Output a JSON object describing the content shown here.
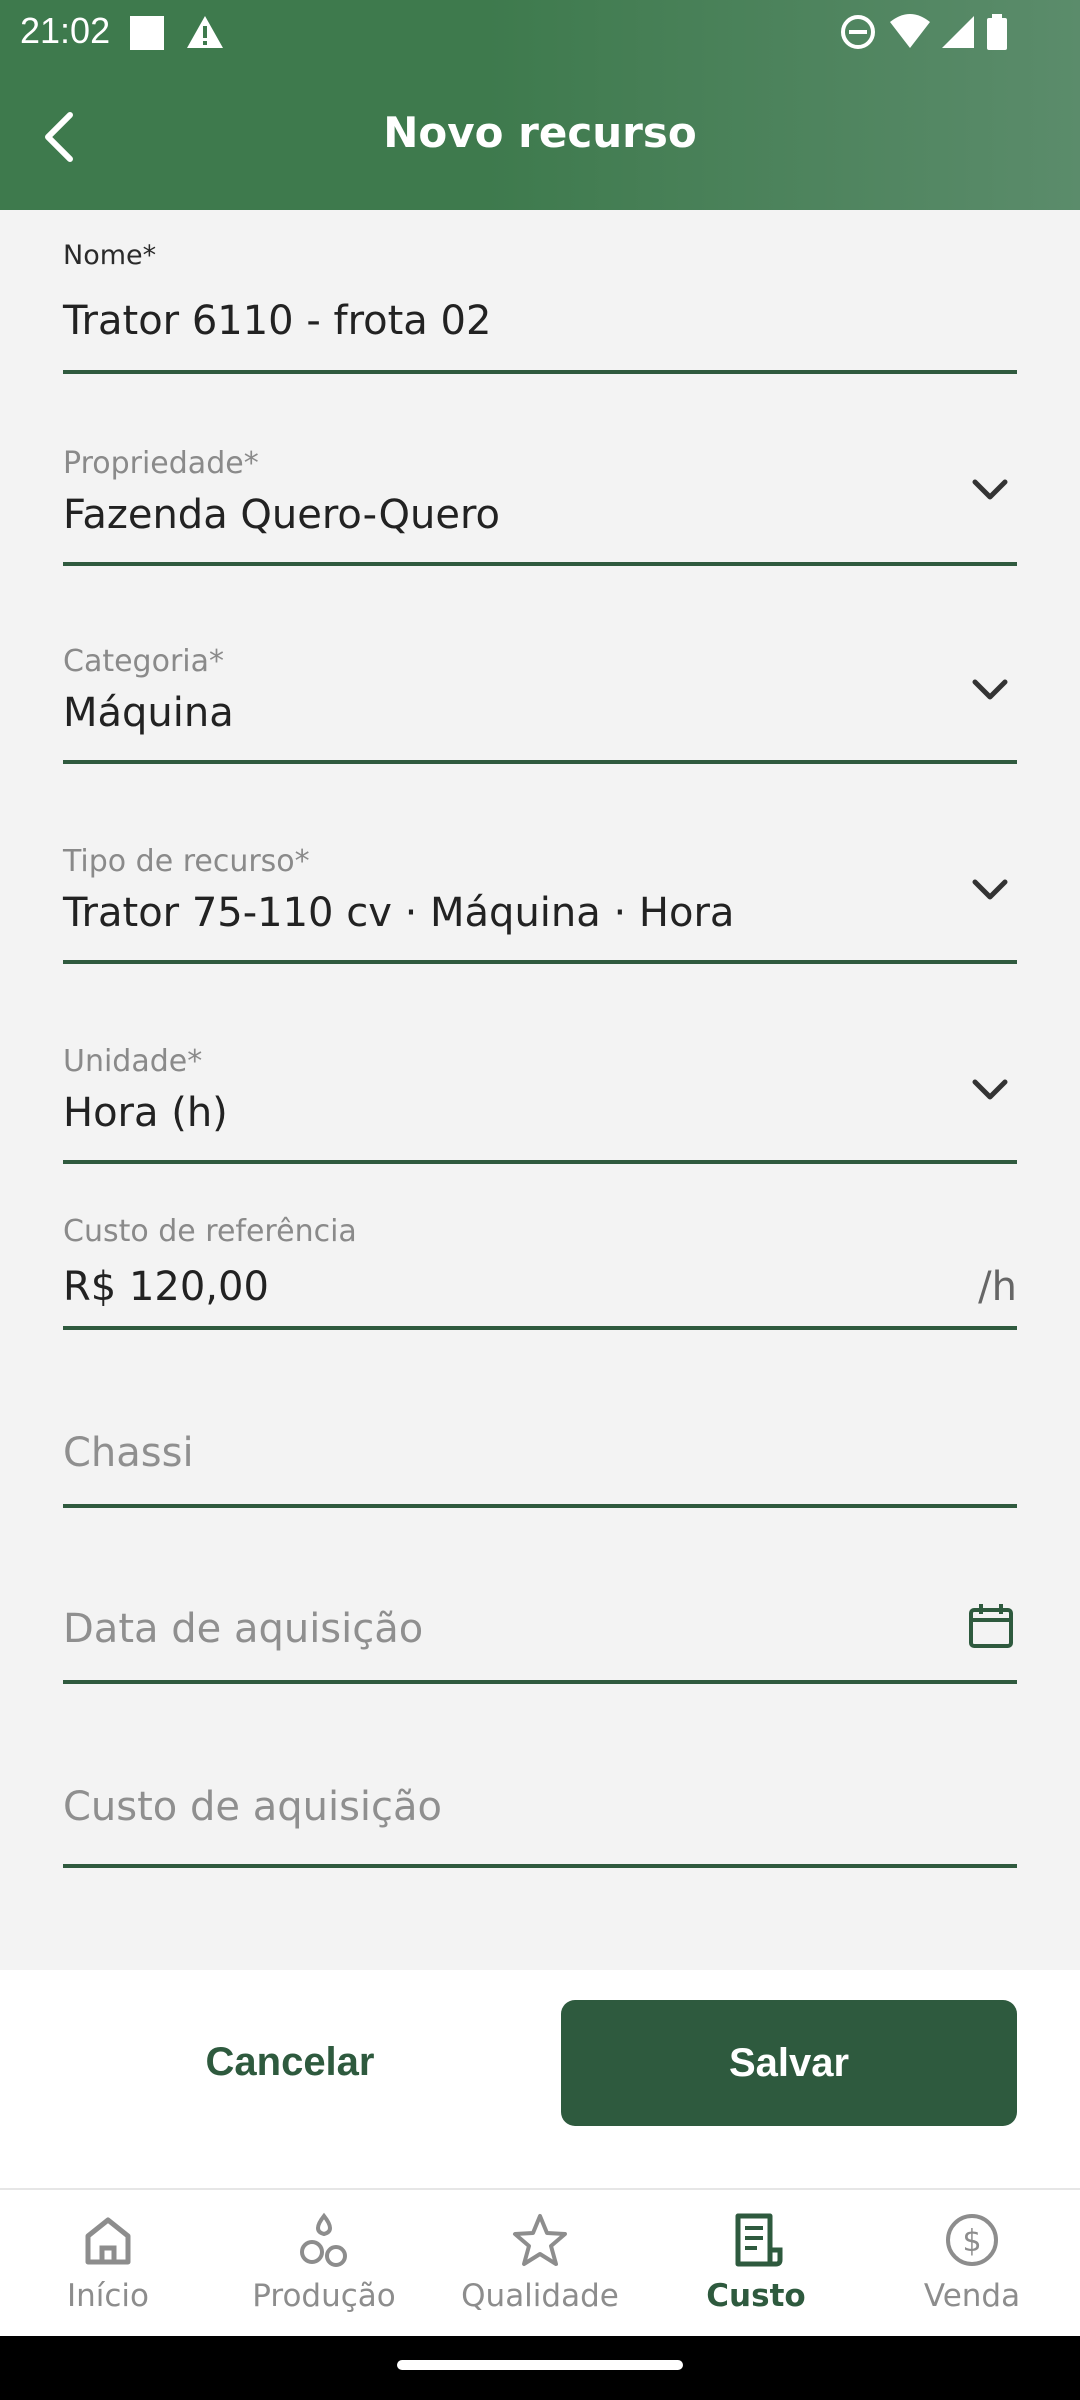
{
  "status_bar": {
    "time": "21:02"
  },
  "app_bar": {
    "title": "Novo recurso"
  },
  "form": {
    "nome": {
      "label": "Nome*",
      "value": "Trator 6110 - frota 02"
    },
    "propriedade": {
      "label": "Propriedade*",
      "value": "Fazenda Quero-Quero"
    },
    "categoria": {
      "label": "Categoria*",
      "value": "Máquina"
    },
    "tipo_recurso": {
      "label": "Tipo de recurso*",
      "value": "Trator 75-110 cv · Máquina · Hora"
    },
    "unidade": {
      "label": "Unidade*",
      "value": "Hora (h)"
    },
    "custo_referencia": {
      "label": "Custo de referência",
      "value": "R$ 120,00",
      "suffix": "/h"
    },
    "chassi": {
      "placeholder": "Chassi"
    },
    "data_aquisicao": {
      "placeholder": "Data de aquisição"
    },
    "custo_aquisicao": {
      "placeholder": "Custo de aquisição"
    }
  },
  "actions": {
    "cancel_label": "Cancelar",
    "save_label": "Salvar"
  },
  "bottom_nav": {
    "items": [
      {
        "label": "Início",
        "icon": "home-icon"
      },
      {
        "label": "Produção",
        "icon": "drops-icon"
      },
      {
        "label": "Qualidade",
        "icon": "star-icon"
      },
      {
        "label": "Custo",
        "icon": "receipt-icon",
        "active": true
      },
      {
        "label": "Venda",
        "icon": "dollar-circle-icon"
      }
    ]
  },
  "colors": {
    "primary": "#2e5a3e",
    "appbar": "#3e7a4d",
    "background": "#f3f3f3"
  }
}
